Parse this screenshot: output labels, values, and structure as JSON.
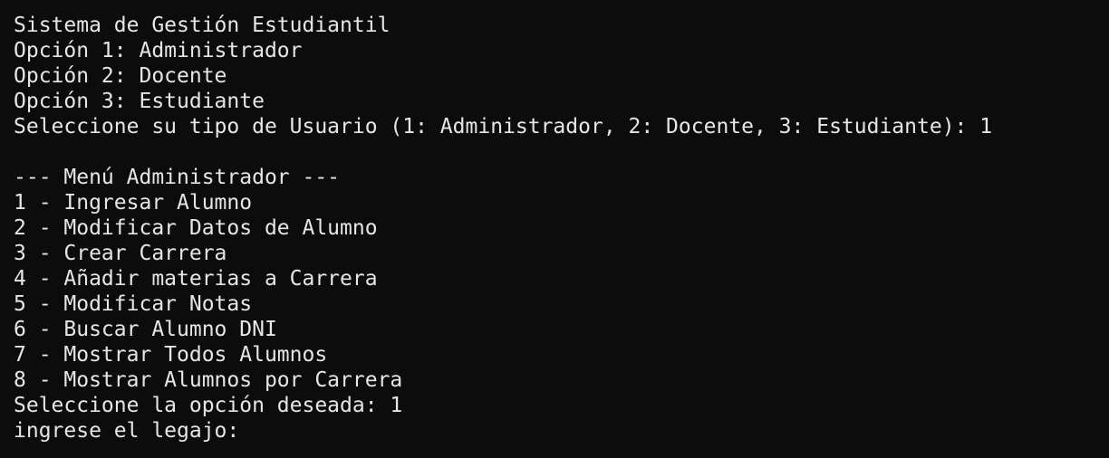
{
  "terminal": {
    "header": {
      "title": "Sistema de Gestión Estudiantil",
      "option1": "Opción 1: Administrador",
      "option2": "Opción 2: Docente",
      "option3": "Opción 3: Estudiante",
      "prompt_user_type": "Seleccione su tipo de Usuario (1: Administrador, 2: Docente, 3: Estudiante): 1"
    },
    "blank": "",
    "admin_menu": {
      "title": "--- Menú Administrador ---",
      "items": [
        "1 - Ingresar Alumno",
        "2 - Modificar Datos de Alumno",
        "3 - Crear Carrera",
        "4 - Añadir materias a Carrera",
        "5 - Modificar Notas",
        "6 - Buscar Alumno DNI",
        "7 - Mostrar Todos Alumnos",
        "8 - Mostrar Alumnos por Carrera"
      ],
      "prompt_option": "Seleccione la opción deseada: 1",
      "prompt_legajo": "ingrese el legajo:"
    }
  }
}
